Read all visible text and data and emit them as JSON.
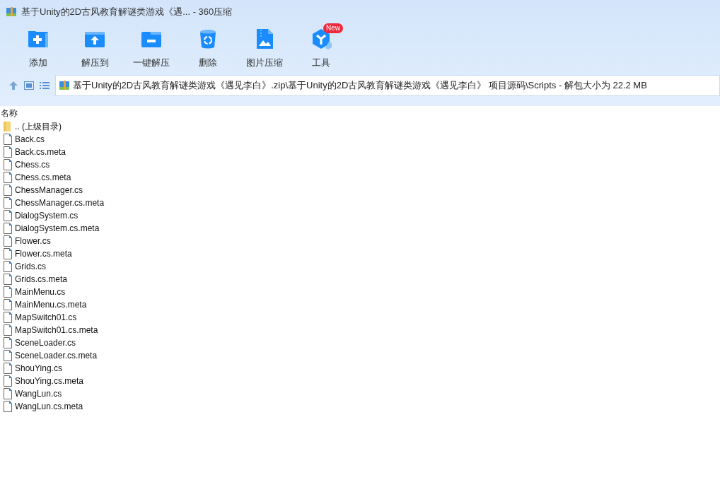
{
  "window": {
    "title": "基于Unity的2D古风教育解谜类游戏《遇... - 360压缩"
  },
  "toolbar": [
    {
      "kind": "add",
      "label": "添加"
    },
    {
      "kind": "extract-to",
      "label": "解压到"
    },
    {
      "kind": "one-click",
      "label": "一键解压"
    },
    {
      "kind": "delete",
      "label": "删除"
    },
    {
      "kind": "image",
      "label": "图片压缩"
    },
    {
      "kind": "tools",
      "label": "工具",
      "badge": "New"
    }
  ],
  "address_bar": {
    "path": "基于Unity的2D古风教育解谜类游戏《遇见李白》.zip\\基于Unity的2D古风教育解谜类游戏《遇见李白》 项目源码\\Scripts - 解包大小为 22.2 MB"
  },
  "file_list": {
    "columns": [
      "名称"
    ],
    "rows": [
      {
        "kind": "folder",
        "name": ".. (上级目录)"
      },
      {
        "kind": "file",
        "name": "Back.cs"
      },
      {
        "kind": "file",
        "name": "Back.cs.meta"
      },
      {
        "kind": "file",
        "name": "Chess.cs"
      },
      {
        "kind": "file",
        "name": "Chess.cs.meta"
      },
      {
        "kind": "file",
        "name": "ChessManager.cs"
      },
      {
        "kind": "file",
        "name": "ChessManager.cs.meta"
      },
      {
        "kind": "file",
        "name": "DialogSystem.cs"
      },
      {
        "kind": "file",
        "name": "DialogSystem.cs.meta"
      },
      {
        "kind": "file",
        "name": "Flower.cs"
      },
      {
        "kind": "file",
        "name": "Flower.cs.meta"
      },
      {
        "kind": "file",
        "name": "Grids.cs"
      },
      {
        "kind": "file",
        "name": "Grids.cs.meta"
      },
      {
        "kind": "file",
        "name": "MainMenu.cs"
      },
      {
        "kind": "file",
        "name": "MainMenu.cs.meta"
      },
      {
        "kind": "file",
        "name": "MapSwitch01.cs"
      },
      {
        "kind": "file",
        "name": "MapSwitch01.cs.meta"
      },
      {
        "kind": "file",
        "name": "SceneLoader.cs"
      },
      {
        "kind": "file",
        "name": "SceneLoader.cs.meta"
      },
      {
        "kind": "file",
        "name": "ShouYing.cs"
      },
      {
        "kind": "file",
        "name": "ShouYing.cs.meta"
      },
      {
        "kind": "file",
        "name": "WangLun.cs"
      },
      {
        "kind": "file",
        "name": "WangLun.cs.meta"
      }
    ]
  }
}
